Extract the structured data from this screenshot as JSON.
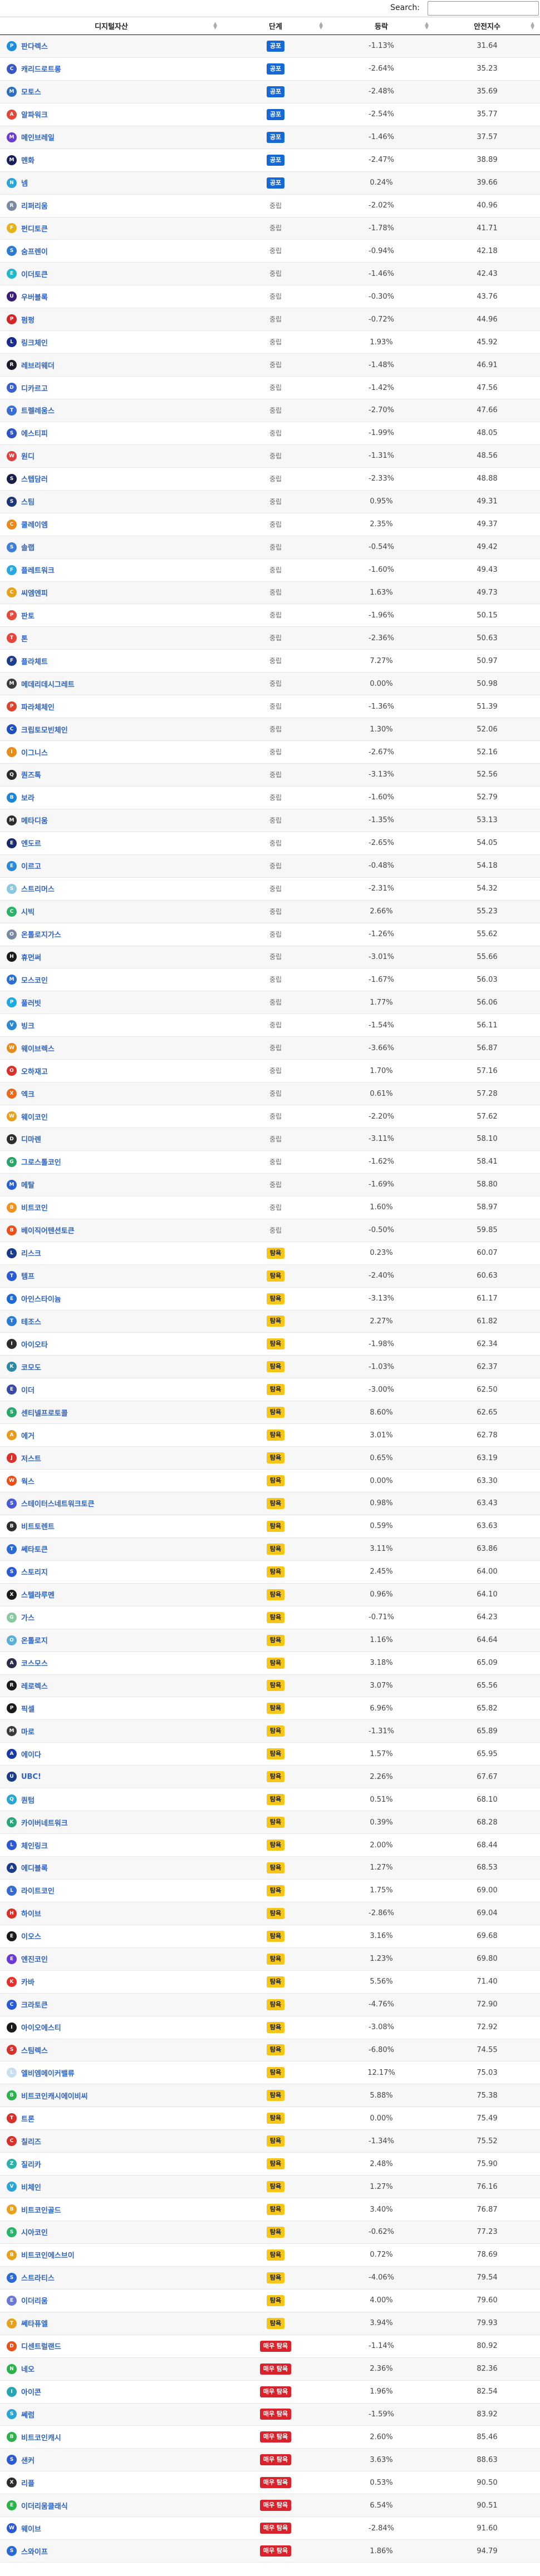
{
  "search": {
    "label": "Search:",
    "value": ""
  },
  "table": {
    "headers": {
      "name": "디지털자산",
      "stage": "단계",
      "change": "등락",
      "price": "안전지수"
    }
  },
  "stage_colors": {
    "b-seed": "#1668d6",
    "b-warn": "#f5c518",
    "b-danger": "#d9232c"
  },
  "rows": [
    {
      "name": "판다렉스",
      "stage": "공포",
      "sc": "b-seed",
      "change": "-1.13%",
      "price": "31.64",
      "color": "#1d8de0",
      "glyph": "P"
    },
    {
      "name": "캐리드로트롱",
      "stage": "공포",
      "sc": "b-seed",
      "change": "-2.64%",
      "price": "35.23",
      "color": "#3a57c4",
      "glyph": "C"
    },
    {
      "name": "모토스",
      "stage": "공포",
      "sc": "b-seed",
      "change": "-2.48%",
      "price": "35.69",
      "color": "#2a6fc0",
      "glyph": "M"
    },
    {
      "name": "알파워크",
      "stage": "공포",
      "sc": "b-seed",
      "change": "-2.54%",
      "price": "35.77",
      "color": "#e0483a",
      "glyph": "A"
    },
    {
      "name": "메인브레일",
      "stage": "공포",
      "sc": "b-seed",
      "change": "-1.46%",
      "price": "37.57",
      "color": "#6b3bd6",
      "glyph": "M"
    },
    {
      "name": "멘화",
      "stage": "공포",
      "sc": "b-seed",
      "change": "-2.47%",
      "price": "38.89",
      "color": "#1a1f5c",
      "glyph": "M"
    },
    {
      "name": "넴",
      "stage": "공포",
      "sc": "b-seed",
      "change": "0.24%",
      "price": "39.66",
      "color": "#2aa6d6",
      "glyph": "N"
    },
    {
      "name": "리퍼리움",
      "stage": "중립",
      "sc": "b-mid",
      "change": "-2.02%",
      "price": "40.96",
      "color": "#7a8aa0",
      "glyph": "R"
    },
    {
      "name": "펀디토큰",
      "stage": "중립",
      "sc": "b-mid",
      "change": "-1.78%",
      "price": "41.71",
      "color": "#e6b21c",
      "glyph": "F"
    },
    {
      "name": "숨프렌이",
      "stage": "중립",
      "sc": "b-mid",
      "change": "-0.94%",
      "price": "42.18",
      "color": "#2c7ad1",
      "glyph": "S"
    },
    {
      "name": "이더토큰",
      "stage": "중립",
      "sc": "b-mid",
      "change": "-1.46%",
      "price": "42.43",
      "color": "#21b9c9",
      "glyph": "E"
    },
    {
      "name": "우버블록",
      "stage": "중립",
      "sc": "b-mid",
      "change": "-0.30%",
      "price": "43.76",
      "color": "#3d1d7a",
      "glyph": "U"
    },
    {
      "name": "펌펑",
      "stage": "중립",
      "sc": "b-mid",
      "change": "-0.72%",
      "price": "44.96",
      "color": "#d12727",
      "glyph": "P"
    },
    {
      "name": "링크체인",
      "stage": "중립",
      "sc": "b-mid",
      "change": "1.93%",
      "price": "45.92",
      "color": "#1a2d8c",
      "glyph": "L"
    },
    {
      "name": "레브리웨더",
      "stage": "중립",
      "sc": "b-mid",
      "change": "-1.48%",
      "price": "46.91",
      "color": "#1a1a2a",
      "glyph": "R"
    },
    {
      "name": "디카르고",
      "stage": "중립",
      "sc": "b-mid",
      "change": "-1.42%",
      "price": "47.56",
      "color": "#3a5fd1",
      "glyph": "D"
    },
    {
      "name": "트렐레움스",
      "stage": "중립",
      "sc": "b-mid",
      "change": "-2.70%",
      "price": "47.66",
      "color": "#3a6ed6",
      "glyph": "T"
    },
    {
      "name": "에스티피",
      "stage": "중립",
      "sc": "b-mid",
      "change": "-1.99%",
      "price": "48.05",
      "color": "#2f54c8",
      "glyph": "S"
    },
    {
      "name": "원디",
      "stage": "중립",
      "sc": "b-mid",
      "change": "-1.31%",
      "price": "48.56",
      "color": "#e03f3f",
      "glyph": "W"
    },
    {
      "name": "스텝담러",
      "stage": "중립",
      "sc": "b-mid",
      "change": "-2.33%",
      "price": "48.88",
      "color": "#1a1f4a",
      "glyph": "S"
    },
    {
      "name": "스팀",
      "stage": "중립",
      "sc": "b-mid",
      "change": "0.95%",
      "price": "49.31",
      "color": "#1d3575",
      "glyph": "S"
    },
    {
      "name": "쿨레이엠",
      "stage": "중립",
      "sc": "b-mid",
      "change": "2.35%",
      "price": "49.37",
      "color": "#e88a1a",
      "glyph": "C"
    },
    {
      "name": "솔랩",
      "stage": "중립",
      "sc": "b-mid",
      "change": "-0.54%",
      "price": "49.42",
      "color": "#3d7fd6",
      "glyph": "S"
    },
    {
      "name": "플레트워크",
      "stage": "중립",
      "sc": "b-mid",
      "change": "-1.60%",
      "price": "49.43",
      "color": "#2aa6e0",
      "glyph": "F"
    },
    {
      "name": "씨엠엔피",
      "stage": "중립",
      "sc": "b-mid",
      "change": "1.63%",
      "price": "49.73",
      "color": "#e7a21c",
      "glyph": "C"
    },
    {
      "name": "판토",
      "stage": "중립",
      "sc": "b-mid",
      "change": "-1.96%",
      "price": "50.15",
      "color": "#e54a3a",
      "glyph": "P"
    },
    {
      "name": "톤",
      "stage": "중립",
      "sc": "b-mid",
      "change": "-2.36%",
      "price": "50.63",
      "color": "#e8453a",
      "glyph": "T"
    },
    {
      "name": "플라체트",
      "stage": "중립",
      "sc": "b-mid",
      "change": "7.27%",
      "price": "50.97",
      "color": "#1d3f8a",
      "glyph": "F"
    },
    {
      "name": "메데리데시그레트",
      "stage": "중립",
      "sc": "b-mid",
      "change": "0.00%",
      "price": "50.98",
      "color": "#3c3c3c",
      "glyph": "M"
    },
    {
      "name": "파라체체인",
      "stage": "중립",
      "sc": "b-mid",
      "change": "-1.36%",
      "price": "51.39",
      "color": "#d9452f",
      "glyph": "P"
    },
    {
      "name": "크립토모빈체인",
      "stage": "중립",
      "sc": "b-mid",
      "change": "1.30%",
      "price": "52.06",
      "color": "#1f4fbf",
      "glyph": "C"
    },
    {
      "name": "이그니스",
      "stage": "중립",
      "sc": "b-mid",
      "change": "-2.67%",
      "price": "52.16",
      "color": "#e88c1c",
      "glyph": "I"
    },
    {
      "name": "퀀즈톡",
      "stage": "중립",
      "sc": "b-mid",
      "change": "-3.13%",
      "price": "52.56",
      "color": "#2b2b2b",
      "glyph": "Q"
    },
    {
      "name": "보라",
      "stage": "중립",
      "sc": "b-mid",
      "change": "-1.60%",
      "price": "52.79",
      "color": "#1a87d6",
      "glyph": "B"
    },
    {
      "name": "메타디움",
      "stage": "중립",
      "sc": "b-mid",
      "change": "-1.35%",
      "price": "53.13",
      "color": "#2d2d2d",
      "glyph": "M"
    },
    {
      "name": "엔도르",
      "stage": "중립",
      "sc": "b-mid",
      "change": "-2.65%",
      "price": "54.05",
      "color": "#1a2a6a",
      "glyph": "E"
    },
    {
      "name": "이르고",
      "stage": "중립",
      "sc": "b-mid",
      "change": "-0.48%",
      "price": "54.18",
      "color": "#2a88d6",
      "glyph": "E"
    },
    {
      "name": "스트리머스",
      "stage": "중립",
      "sc": "b-mid",
      "change": "-2.31%",
      "price": "54.32",
      "color": "#8ac9e0",
      "glyph": "S"
    },
    {
      "name": "시빅",
      "stage": "중립",
      "sc": "b-mid",
      "change": "2.66%",
      "price": "55.23",
      "color": "#2bb36a",
      "glyph": "C"
    },
    {
      "name": "온톨로지가스",
      "stage": "중립",
      "sc": "b-mid",
      "change": "-1.26%",
      "price": "55.62",
      "color": "#7a8aa0",
      "glyph": "O"
    },
    {
      "name": "휴먼써",
      "stage": "중립",
      "sc": "b-mid",
      "change": "-3.01%",
      "price": "55.66",
      "color": "#1a1a1a",
      "glyph": "H"
    },
    {
      "name": "모스코인",
      "stage": "중립",
      "sc": "b-mid",
      "change": "-1.67%",
      "price": "56.03",
      "color": "#2a6ed6",
      "glyph": "M"
    },
    {
      "name": "풀러빗",
      "stage": "중립",
      "sc": "b-mid",
      "change": "1.77%",
      "price": "56.06",
      "color": "#1fa7e0",
      "glyph": "P"
    },
    {
      "name": "빙크",
      "stage": "중립",
      "sc": "b-mid",
      "change": "-1.54%",
      "price": "56.11",
      "color": "#2a8ad6",
      "glyph": "V"
    },
    {
      "name": "웨이브렉스",
      "stage": "중립",
      "sc": "b-mid",
      "change": "-3.66%",
      "price": "56.87",
      "color": "#e38b1c",
      "glyph": "W"
    },
    {
      "name": "오하재고",
      "stage": "중립",
      "sc": "b-mid",
      "change": "1.70%",
      "price": "57.16",
      "color": "#d9302a",
      "glyph": "O"
    },
    {
      "name": "엑크",
      "stage": "중립",
      "sc": "b-mid",
      "change": "0.61%",
      "price": "57.28",
      "color": "#e86a1c",
      "glyph": "X"
    },
    {
      "name": "웨이코인",
      "stage": "중립",
      "sc": "b-mid",
      "change": "-2.20%",
      "price": "57.62",
      "color": "#e8a11c",
      "glyph": "W"
    },
    {
      "name": "디마렌",
      "stage": "중립",
      "sc": "b-mid",
      "change": "-3.11%",
      "price": "58.10",
      "color": "#2d2d2d",
      "glyph": "D"
    },
    {
      "name": "그로스톨코인",
      "stage": "중립",
      "sc": "b-mid",
      "change": "-1.62%",
      "price": "58.41",
      "color": "#2ba36a",
      "glyph": "G"
    },
    {
      "name": "메탈",
      "stage": "중립",
      "sc": "b-mid",
      "change": "-1.69%",
      "price": "58.80",
      "color": "#2a5fd6",
      "glyph": "M"
    },
    {
      "name": "비트코인",
      "stage": "중립",
      "sc": "b-mid",
      "change": "1.60%",
      "price": "58.97",
      "color": "#f2921c",
      "glyph": "B"
    },
    {
      "name": "베이직어텐션토큰",
      "stage": "중립",
      "sc": "b-mid",
      "change": "-0.50%",
      "price": "59.85",
      "color": "#e8501c",
      "glyph": "B"
    },
    {
      "name": "리스크",
      "stage": "탐욕",
      "sc": "b-warn",
      "change": "0.23%",
      "price": "60.07",
      "color": "#1a3a8a",
      "glyph": "L"
    },
    {
      "name": "템프",
      "stage": "탐욕",
      "sc": "b-warn",
      "change": "-2.40%",
      "price": "60.63",
      "color": "#2a5ad6",
      "glyph": "T"
    },
    {
      "name": "아인스타이늄",
      "stage": "탐욕",
      "sc": "b-warn",
      "change": "-3.13%",
      "price": "61.17",
      "color": "#1d6ad6",
      "glyph": "E"
    },
    {
      "name": "테조스",
      "stage": "탐욕",
      "sc": "b-warn",
      "change": "2.27%",
      "price": "61.82",
      "color": "#2a7ad6",
      "glyph": "T"
    },
    {
      "name": "아이오타",
      "stage": "탐욕",
      "sc": "b-warn",
      "change": "-1.98%",
      "price": "62.34",
      "color": "#2d2d2d",
      "glyph": "I"
    },
    {
      "name": "코모도",
      "stage": "탐욕",
      "sc": "b-warn",
      "change": "-1.03%",
      "price": "62.37",
      "color": "#2a8aa6",
      "glyph": "K"
    },
    {
      "name": "이더",
      "stage": "탐욕",
      "sc": "b-warn",
      "change": "-3.00%",
      "price": "62.50",
      "color": "#3a4aa6",
      "glyph": "E"
    },
    {
      "name": "센티넬프로토콜",
      "stage": "탐욕",
      "sc": "b-warn",
      "change": "8.60%",
      "price": "62.65",
      "color": "#2aa66a",
      "glyph": "S"
    },
    {
      "name": "에거",
      "stage": "탐욕",
      "sc": "b-warn",
      "change": "3.01%",
      "price": "62.78",
      "color": "#e89a1c",
      "glyph": "A"
    },
    {
      "name": "저스트",
      "stage": "탐욕",
      "sc": "b-warn",
      "change": "0.65%",
      "price": "63.19",
      "color": "#d9302a",
      "glyph": "J"
    },
    {
      "name": "웍스",
      "stage": "탐욕",
      "sc": "b-warn",
      "change": "0.00%",
      "price": "63.30",
      "color": "#e8501c",
      "glyph": "W"
    },
    {
      "name": "스테이터스네트워크토큰",
      "stage": "탐욕",
      "sc": "b-warn",
      "change": "0.98%",
      "price": "63.43",
      "color": "#4a5ad6",
      "glyph": "S"
    },
    {
      "name": "비트토렌트",
      "stage": "탐욕",
      "sc": "b-warn",
      "change": "0.59%",
      "price": "63.63",
      "color": "#2d2d2d",
      "glyph": "B"
    },
    {
      "name": "쎄타토큰",
      "stage": "탐욕",
      "sc": "b-warn",
      "change": "3.11%",
      "price": "63.86",
      "color": "#2a6ad6",
      "glyph": "T"
    },
    {
      "name": "스토리지",
      "stage": "탐욕",
      "sc": "b-warn",
      "change": "2.45%",
      "price": "64.00",
      "color": "#2a5ad6",
      "glyph": "S"
    },
    {
      "name": "스텔라루멘",
      "stage": "탐욕",
      "sc": "b-warn",
      "change": "0.96%",
      "price": "64.10",
      "color": "#1a1a1a",
      "glyph": "X"
    },
    {
      "name": "가스",
      "stage": "탐욕",
      "sc": "b-warn",
      "change": "-0.71%",
      "price": "64.23",
      "color": "#8ac9a0",
      "glyph": "G"
    },
    {
      "name": "온톨로지",
      "stage": "탐욕",
      "sc": "b-warn",
      "change": "1.16%",
      "price": "64.64",
      "color": "#5ab0d6",
      "glyph": "O"
    },
    {
      "name": "코스모스",
      "stage": "탐욕",
      "sc": "b-warn",
      "change": "3.18%",
      "price": "65.09",
      "color": "#2d2d4a",
      "glyph": "A"
    },
    {
      "name": "레로렉스",
      "stage": "탐욕",
      "sc": "b-warn",
      "change": "3.07%",
      "price": "65.56",
      "color": "#1a1a1a",
      "glyph": "R"
    },
    {
      "name": "픽셀",
      "stage": "탐욕",
      "sc": "b-warn",
      "change": "6.96%",
      "price": "65.82",
      "color": "#1a1a1a",
      "glyph": "P"
    },
    {
      "name": "마로",
      "stage": "탐욕",
      "sc": "b-warn",
      "change": "-1.31%",
      "price": "65.89",
      "color": "#3a3a3a",
      "glyph": "M"
    },
    {
      "name": "에이다",
      "stage": "탐욕",
      "sc": "b-warn",
      "change": "1.57%",
      "price": "65.95",
      "color": "#1a3aa6",
      "glyph": "A"
    },
    {
      "name": "UBC!",
      "stage": "탐욕",
      "sc": "b-warn",
      "change": "2.26%",
      "price": "67.67",
      "color": "#1a3a8a",
      "glyph": "U"
    },
    {
      "name": "퀀텀",
      "stage": "탐욕",
      "sc": "b-warn",
      "change": "0.51%",
      "price": "68.10",
      "color": "#2aa6d6",
      "glyph": "Q"
    },
    {
      "name": "카이버네트워크",
      "stage": "탐욕",
      "sc": "b-warn",
      "change": "0.39%",
      "price": "68.28",
      "color": "#2aa67a",
      "glyph": "K"
    },
    {
      "name": "체인링크",
      "stage": "탐욕",
      "sc": "b-warn",
      "change": "2.00%",
      "price": "68.44",
      "color": "#2a5ad6",
      "glyph": "L"
    },
    {
      "name": "에디블록",
      "stage": "탐욕",
      "sc": "b-warn",
      "change": "1.27%",
      "price": "68.53",
      "color": "#1a3a8a",
      "glyph": "A"
    },
    {
      "name": "라이트코인",
      "stage": "탐욕",
      "sc": "b-warn",
      "change": "1.75%",
      "price": "69.00",
      "color": "#3a6ad6",
      "glyph": "L"
    },
    {
      "name": "하이브",
      "stage": "탐욕",
      "sc": "b-warn",
      "change": "-2.86%",
      "price": "69.04",
      "color": "#d9302a",
      "glyph": "H"
    },
    {
      "name": "이오스",
      "stage": "탐욕",
      "sc": "b-warn",
      "change": "3.16%",
      "price": "69.68",
      "color": "#1a1a1a",
      "glyph": "E"
    },
    {
      "name": "엔진코인",
      "stage": "탐욕",
      "sc": "b-warn",
      "change": "1.23%",
      "price": "69.80",
      "color": "#6a3ad6",
      "glyph": "E"
    },
    {
      "name": "카바",
      "stage": "탐욕",
      "sc": "b-warn",
      "change": "5.56%",
      "price": "71.40",
      "color": "#e8302a",
      "glyph": "K"
    },
    {
      "name": "크라토큰",
      "stage": "탐욕",
      "sc": "b-warn",
      "change": "-4.76%",
      "price": "72.90",
      "color": "#2a5ad6",
      "glyph": "C"
    },
    {
      "name": "아이오에스티",
      "stage": "탐욕",
      "sc": "b-warn",
      "change": "-3.08%",
      "price": "72.92",
      "color": "#1a1a1a",
      "glyph": "I"
    },
    {
      "name": "스팀렉스",
      "stage": "탐욕",
      "sc": "b-warn",
      "change": "-6.80%",
      "price": "74.55",
      "color": "#d9302a",
      "glyph": "S"
    },
    {
      "name": "엘비엠메이커밸류",
      "stage": "탐욕",
      "sc": "b-warn",
      "change": "12.17%",
      "price": "75.03",
      "color": "#c9e0f0",
      "glyph": "L"
    },
    {
      "name": "비트코인캐시에이비씨",
      "stage": "탐욕",
      "sc": "b-warn",
      "change": "5.88%",
      "price": "75.38",
      "color": "#2ab34a",
      "glyph": "B"
    },
    {
      "name": "트론",
      "stage": "탐욕",
      "sc": "b-warn",
      "change": "0.00%",
      "price": "75.49",
      "color": "#d9302a",
      "glyph": "T"
    },
    {
      "name": "칠리즈",
      "stage": "탐욕",
      "sc": "b-warn",
      "change": "-1.34%",
      "price": "75.52",
      "color": "#d9302a",
      "glyph": "C"
    },
    {
      "name": "질리카",
      "stage": "탐욕",
      "sc": "b-warn",
      "change": "2.48%",
      "price": "75.90",
      "color": "#2ab3a6",
      "glyph": "Z"
    },
    {
      "name": "비체인",
      "stage": "탐욕",
      "sc": "b-warn",
      "change": "1.27%",
      "price": "76.16",
      "color": "#2aa6d6",
      "glyph": "V"
    },
    {
      "name": "비트코인골드",
      "stage": "탐욕",
      "sc": "b-warn",
      "change": "3.40%",
      "price": "76.87",
      "color": "#e8a11c",
      "glyph": "B"
    },
    {
      "name": "시아코인",
      "stage": "탐욕",
      "sc": "b-warn",
      "change": "-0.62%",
      "price": "77.23",
      "color": "#2ab36a",
      "glyph": "S"
    },
    {
      "name": "비트코인에스브이",
      "stage": "탐욕",
      "sc": "b-warn",
      "change": "0.72%",
      "price": "78.69",
      "color": "#e8a11c",
      "glyph": "B"
    },
    {
      "name": "스트라티스",
      "stage": "탐욕",
      "sc": "b-warn",
      "change": "-4.06%",
      "price": "79.54",
      "color": "#2a6ad6",
      "glyph": "S"
    },
    {
      "name": "이더리움",
      "stage": "탐욕",
      "sc": "b-warn",
      "change": "4.00%",
      "price": "79.60",
      "color": "#6a7ad6",
      "glyph": "E"
    },
    {
      "name": "쎄타퓨엘",
      "stage": "탐욕",
      "sc": "b-warn",
      "change": "3.94%",
      "price": "79.93",
      "color": "#e8a11c",
      "glyph": "T"
    },
    {
      "name": "디센트럴랜드",
      "stage": "매우 탐욕",
      "sc": "b-danger",
      "change": "-1.14%",
      "price": "80.92",
      "color": "#e8501c",
      "glyph": "D"
    },
    {
      "name": "네오",
      "stage": "매우 탐욕",
      "sc": "b-danger",
      "change": "2.36%",
      "price": "82.36",
      "color": "#2ab34a",
      "glyph": "N"
    },
    {
      "name": "아이콘",
      "stage": "매우 탐욕",
      "sc": "b-danger",
      "change": "1.96%",
      "price": "82.54",
      "color": "#2aa6b3",
      "glyph": "I"
    },
    {
      "name": "쎄럼",
      "stage": "매우 탐욕",
      "sc": "b-danger",
      "change": "-1.59%",
      "price": "83.92",
      "color": "#2aa6d6",
      "glyph": "S"
    },
    {
      "name": "비트코인캐시",
      "stage": "매우 탐욕",
      "sc": "b-danger",
      "change": "2.60%",
      "price": "85.46",
      "color": "#2ab34a",
      "glyph": "B"
    },
    {
      "name": "샌커",
      "stage": "매우 탐욕",
      "sc": "b-danger",
      "change": "3.63%",
      "price": "88.63",
      "color": "#2a5ad6",
      "glyph": "S"
    },
    {
      "name": "리플",
      "stage": "매우 탐욕",
      "sc": "b-danger",
      "change": "0.53%",
      "price": "90.50",
      "color": "#2d2d2d",
      "glyph": "X"
    },
    {
      "name": "이더리움클래식",
      "stage": "매우 탐욕",
      "sc": "b-danger",
      "change": "6.54%",
      "price": "90.51",
      "color": "#2ab34a",
      "glyph": "E"
    },
    {
      "name": "웨이브",
      "stage": "매우 탐욕",
      "sc": "b-danger",
      "change": "-2.84%",
      "price": "91.60",
      "color": "#2a5ad6",
      "glyph": "W"
    },
    {
      "name": "스와이프",
      "stage": "매우 탐욕",
      "sc": "b-danger",
      "change": "1.86%",
      "price": "94.79",
      "color": "#2a6ad6",
      "glyph": "S"
    }
  ]
}
